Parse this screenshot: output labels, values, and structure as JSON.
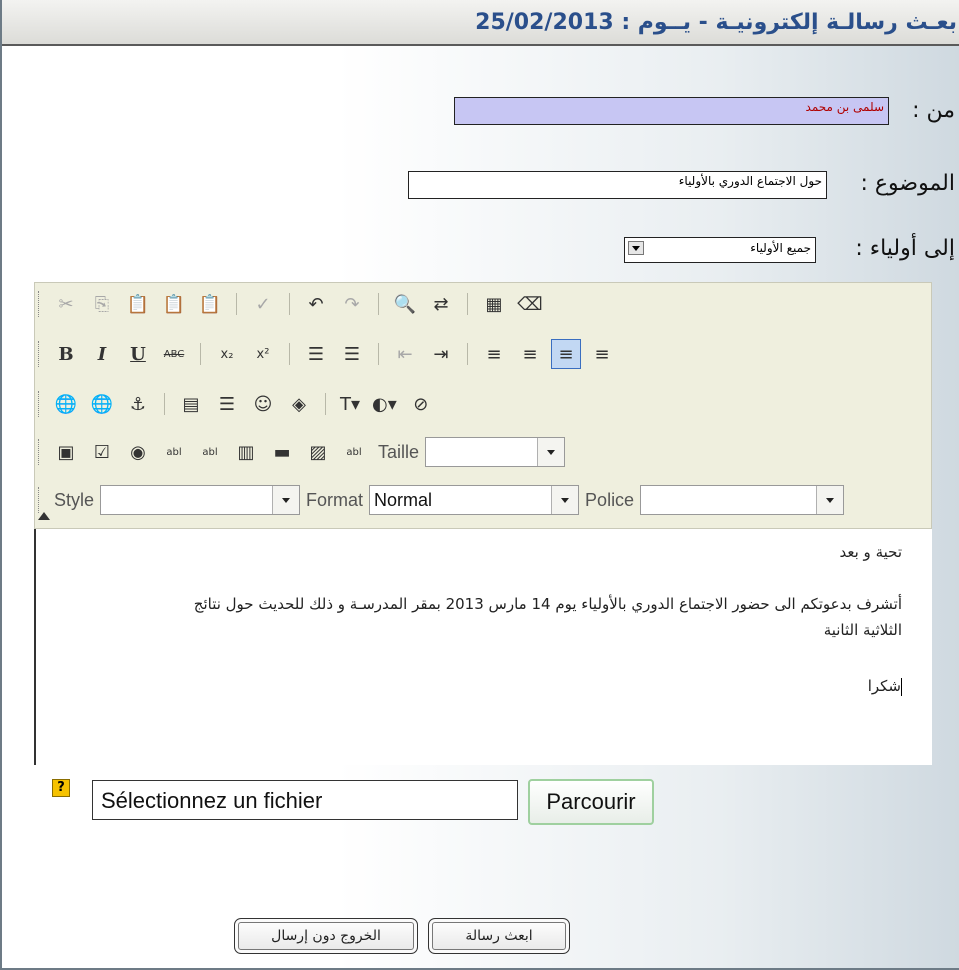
{
  "header": {
    "title": "بعـث رسالـة إلكترونيـة - يــوم : 25/02/2013"
  },
  "form": {
    "from_label": "من :",
    "from_value": "سلمى بن محمد",
    "subject_label": "الموضوع :",
    "subject_value": "حول الاجتماع الدوري بالأولياء",
    "to_label": "إلى أولياء :",
    "to_value": "جميع الأولياء"
  },
  "editor": {
    "size_label": "Taille",
    "style_label": "Style",
    "format_label": "Format",
    "format_value": "Normal",
    "font_label": "Police",
    "body_lines": [
      "تحية و بعد",
      "أتشرف بدعوتكم الى حضور الاجتماع الدوري بالأولياء يوم 14 مارس 2013 بمقر المدرسـة و ذلك للحديث حول نتائج",
      "الثلاثية الثانية",
      "شكرا"
    ]
  },
  "attachment": {
    "placeholder": "Sélectionnez un fichier",
    "browse_label": "Parcourir",
    "help_icon": "?"
  },
  "actions": {
    "send_label": "ابعث رسالة",
    "exit_label": "الخروج دون إرسال"
  }
}
